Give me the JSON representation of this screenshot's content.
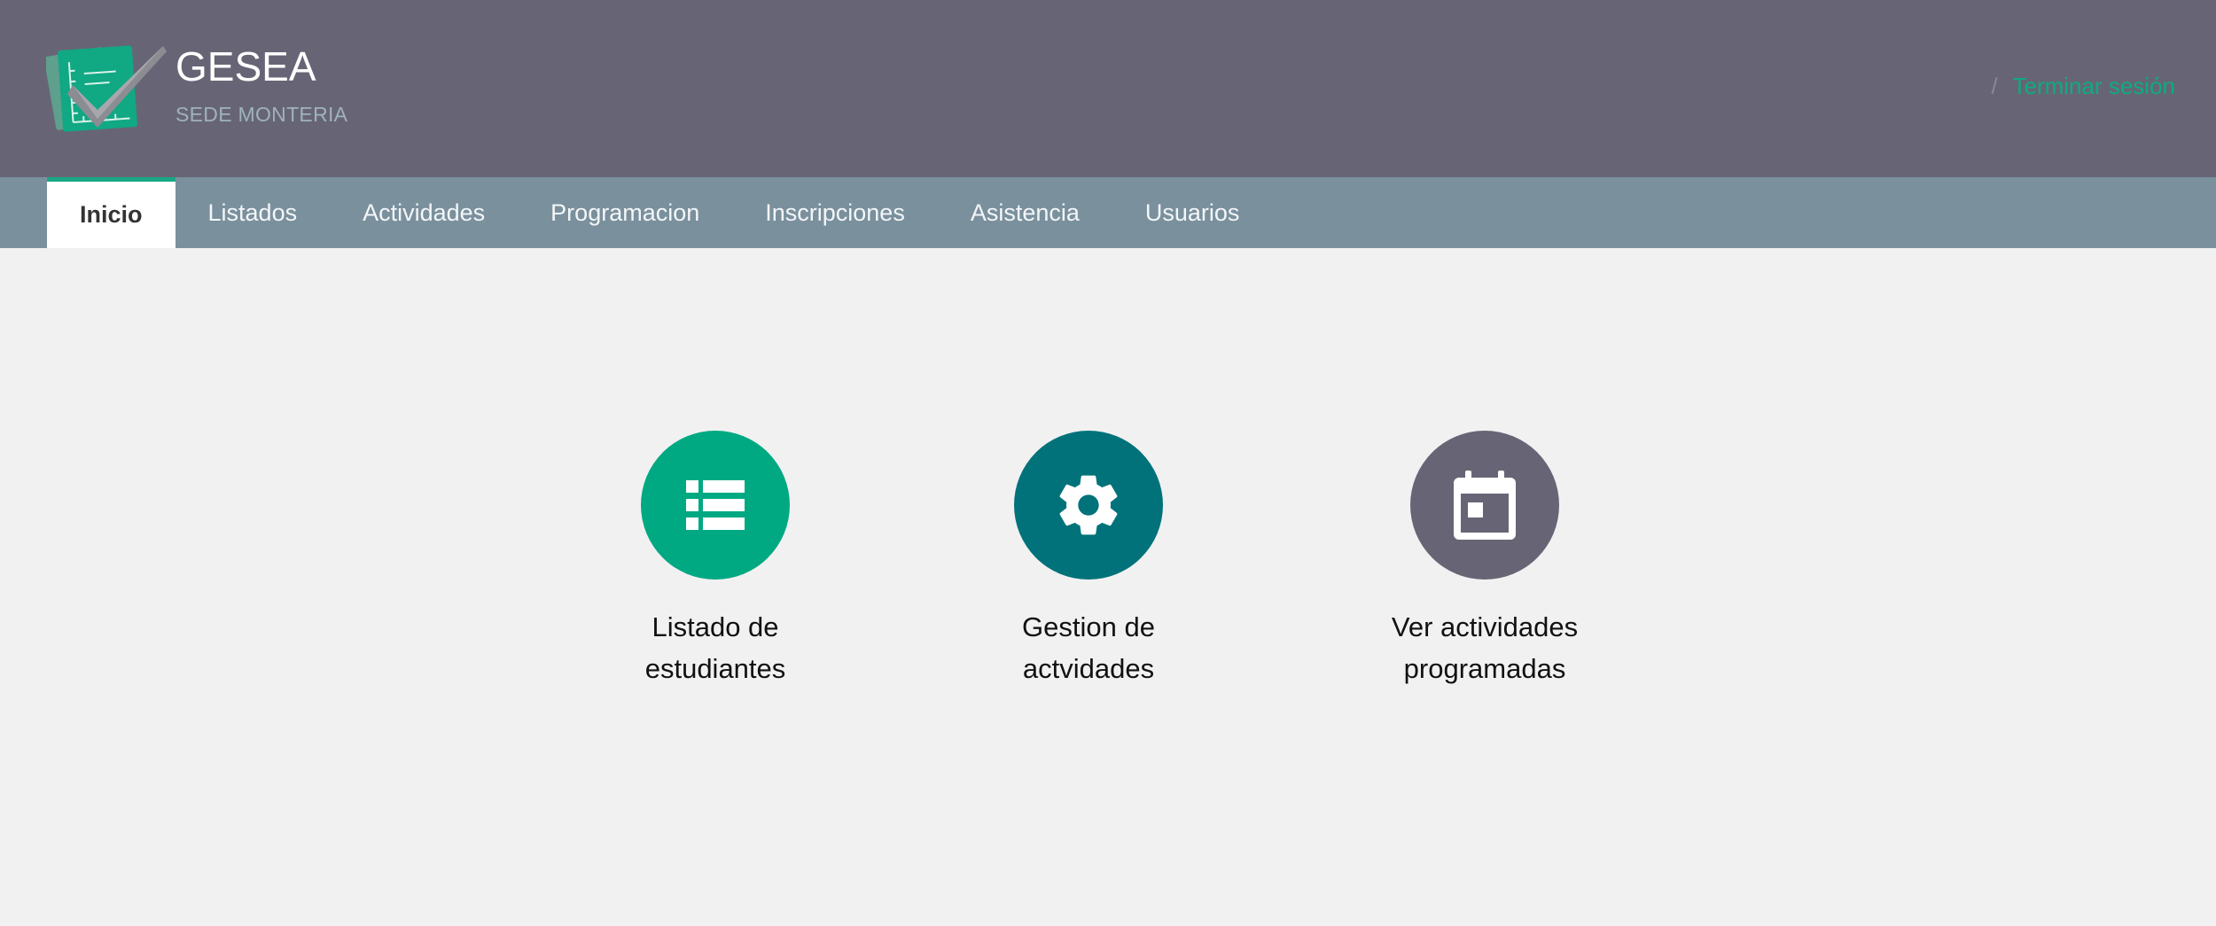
{
  "header": {
    "brand_title": "GESEA",
    "brand_subtitle": "SEDE MONTERIA",
    "logout_separator": "/",
    "logout_label": "Terminar sesión"
  },
  "nav": {
    "items": [
      {
        "label": "Inicio",
        "active": true
      },
      {
        "label": "Listados"
      },
      {
        "label": "Actividades"
      },
      {
        "label": "Programacion"
      },
      {
        "label": "Inscripciones"
      },
      {
        "label": "Asistencia"
      },
      {
        "label": "Usuarios"
      }
    ]
  },
  "tiles": [
    {
      "label": "Listado de\nestudiantes",
      "icon": "list-icon",
      "color": "#00a982"
    },
    {
      "label": "Gestion de\nactvidades",
      "icon": "gear-icon",
      "color": "#01727a"
    },
    {
      "label": "Ver actividades\nprogramadas",
      "icon": "calendar-icon",
      "color": "#676575"
    }
  ],
  "colors": {
    "header_bg": "#676575",
    "nav_bg": "#7a909d",
    "accent": "#0faa82",
    "page_bg": "#f1f1f1"
  }
}
